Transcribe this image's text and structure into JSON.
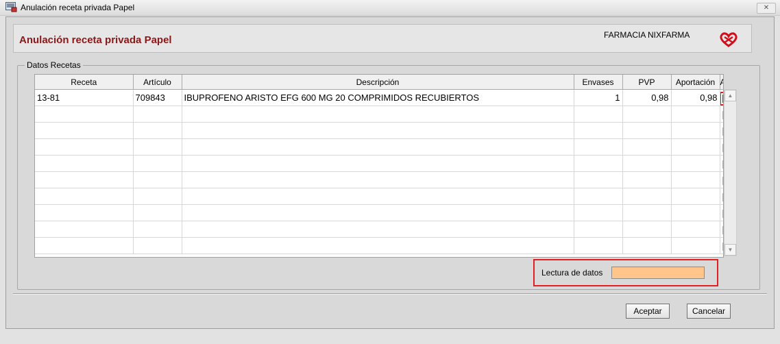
{
  "window": {
    "title": "Anulación receta privada Papel",
    "close_icon": "close-icon"
  },
  "header": {
    "title": "Anulación receta privada Papel",
    "pharmacy": "FARMACIA NIXFARMA",
    "logo": "red-heart-logo"
  },
  "group": {
    "label": "Datos Recetas"
  },
  "table": {
    "columns": [
      "Receta",
      "Artículo",
      "Descripción",
      "Envases",
      "PVP",
      "Aportación",
      "A"
    ],
    "rows": [
      {
        "receta": "13-81",
        "articulo": "709843",
        "descripcion": "IBUPROFENO ARISTO EFG 600 MG 20 COMPRIMIDOS RECUBIERTOS",
        "envases": "1",
        "pvp": "0,98",
        "aportacion": "0,98",
        "checked": true
      },
      {
        "receta": "",
        "articulo": "",
        "descripcion": "",
        "envases": "",
        "pvp": "",
        "aportacion": "",
        "checked": false
      },
      {
        "receta": "",
        "articulo": "",
        "descripcion": "",
        "envases": "",
        "pvp": "",
        "aportacion": "",
        "checked": false
      },
      {
        "receta": "",
        "articulo": "",
        "descripcion": "",
        "envases": "",
        "pvp": "",
        "aportacion": "",
        "checked": false
      },
      {
        "receta": "",
        "articulo": "",
        "descripcion": "",
        "envases": "",
        "pvp": "",
        "aportacion": "",
        "checked": false
      },
      {
        "receta": "",
        "articulo": "",
        "descripcion": "",
        "envases": "",
        "pvp": "",
        "aportacion": "",
        "checked": false
      },
      {
        "receta": "",
        "articulo": "",
        "descripcion": "",
        "envases": "",
        "pvp": "",
        "aportacion": "",
        "checked": false
      },
      {
        "receta": "",
        "articulo": "",
        "descripcion": "",
        "envases": "",
        "pvp": "",
        "aportacion": "",
        "checked": false
      },
      {
        "receta": "",
        "articulo": "",
        "descripcion": "",
        "envases": "",
        "pvp": "",
        "aportacion": "",
        "checked": false
      },
      {
        "receta": "",
        "articulo": "",
        "descripcion": "",
        "envases": "",
        "pvp": "",
        "aportacion": "",
        "checked": false
      }
    ]
  },
  "lectura": {
    "label": "Lectura de datos",
    "value": "",
    "fill_color": "#ffc58a"
  },
  "buttons": {
    "accept": "Aceptar",
    "cancel": "Cancelar"
  },
  "colors": {
    "title_accent": "#8a1818",
    "highlight": "#e02020"
  }
}
